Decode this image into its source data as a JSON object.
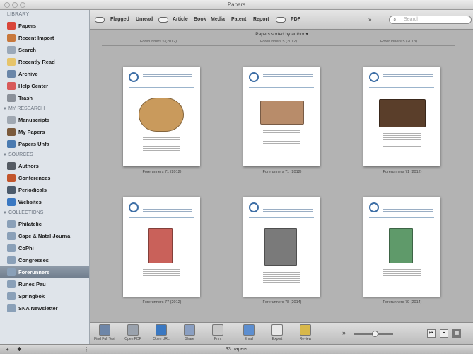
{
  "window": {
    "title": "Papers"
  },
  "sidebar": {
    "library_header": "LIBRARY",
    "library": [
      {
        "label": "Papers",
        "icon": "papers-icon",
        "color": "#d9463a"
      },
      {
        "label": "Recent Import",
        "icon": "import-icon",
        "color": "#c8783c"
      },
      {
        "label": "Search",
        "icon": "search-icon",
        "color": "#9aa8b8"
      },
      {
        "label": "Recently Read",
        "icon": "folder-icon",
        "color": "#e6c46a"
      },
      {
        "label": "Archive",
        "icon": "archive-icon",
        "color": "#6a86a8"
      },
      {
        "label": "Help Center",
        "icon": "lifebuoy-icon",
        "color": "#d85a5a"
      },
      {
        "label": "Trash",
        "icon": "trash-icon",
        "color": "#8a9099"
      }
    ],
    "research_header": "MY RESEARCH",
    "research": [
      {
        "label": "Manuscripts",
        "icon": "manuscript-icon",
        "color": "#a0a8b2"
      },
      {
        "label": "My Papers",
        "icon": "person-icon",
        "color": "#7b5a3c"
      },
      {
        "label": "Papers Unfa",
        "icon": "globe-icon",
        "color": "#4a7ab0"
      }
    ],
    "sources_header": "SOURCES",
    "sources": [
      {
        "label": "Authors",
        "icon": "author-icon",
        "color": "#555b63"
      },
      {
        "label": "Conferences",
        "icon": "conference-icon",
        "color": "#c2552c"
      },
      {
        "label": "Periodicals",
        "icon": "periodical-icon",
        "color": "#4b5a6b"
      },
      {
        "label": "Websites",
        "icon": "website-icon",
        "color": "#3a78c2"
      }
    ],
    "collections_header": "COLLECTIONS",
    "collections": [
      {
        "label": "Philatelic",
        "icon": "collection-icon",
        "color": "#8aa0b8"
      },
      {
        "label": "Cape & Natal Journa",
        "icon": "collection-icon",
        "color": "#8aa0b8"
      },
      {
        "label": "CoPhi",
        "icon": "collection-icon",
        "color": "#8aa0b8"
      },
      {
        "label": "Congresses",
        "icon": "collection-icon",
        "color": "#8aa0b8"
      },
      {
        "label": "Forerunners",
        "icon": "collection-icon",
        "color": "#8aa0b8",
        "selected": true
      },
      {
        "label": "Runes Pau",
        "icon": "collection-icon",
        "color": "#8aa0b8"
      },
      {
        "label": "Springbok",
        "icon": "collection-icon",
        "color": "#8aa0b8"
      },
      {
        "label": "SNA Newsletter",
        "icon": "collection-icon",
        "color": "#8aa0b8"
      }
    ]
  },
  "toolbar": {
    "filters": [
      "Flagged",
      "Unread",
      "Article",
      "Book",
      "Media",
      "Patent",
      "Report",
      "PDF"
    ],
    "search_placeholder": "Search"
  },
  "content": {
    "sort_label": "Papers sorted by author ▾",
    "top_captions": [
      "Forerunners 5 (2012)",
      "Forerunners 5 (2012)",
      "Forerunners 5 (2013)"
    ],
    "cards": [
      {
        "caption": "Forerunners 71 (2012)",
        "image": "fish-image",
        "img_color": "#c99a5c"
      },
      {
        "caption": "Forerunners 71 (2012)",
        "image": "document-image",
        "img_color": "#b88c6a"
      },
      {
        "caption": "Forerunners 71 (2012)",
        "image": "photo-image",
        "img_color": "#5a3e2a"
      },
      {
        "caption": "Forerunners 77 (2012)",
        "image": "stamp-image",
        "img_color": "#c9615a"
      },
      {
        "caption": "Forerunners 78 (2014)",
        "image": "portrait-image",
        "img_color": "#7a7a7a"
      },
      {
        "caption": "Forerunners 79 (2014)",
        "image": "stamp-image",
        "img_color": "#5f9a6a"
      }
    ]
  },
  "bottombar": {
    "tools": [
      "Find Full Text",
      "Open PDF",
      "Open URL",
      "Share",
      "Print",
      "Email",
      "Export",
      "Review"
    ]
  },
  "statusbar": {
    "count": "33 papers"
  }
}
